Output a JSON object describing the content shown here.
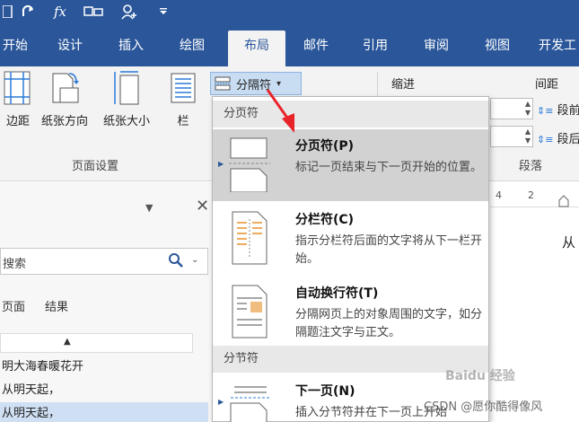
{
  "quick_access": {
    "formula_symbol": "fx"
  },
  "tabs": [
    "开始",
    "设计",
    "插入",
    "绘图",
    "布局",
    "邮件",
    "引用",
    "审阅",
    "视图",
    "开发工"
  ],
  "active_tab": "布局",
  "ribbon": {
    "margins_label": "边距",
    "orientation_label": "纸张方向",
    "size_label": "纸张大小",
    "columns_label": "栏",
    "page_setup_group": "页面设置",
    "breaks_label": "分隔符",
    "indent_label": "缩进",
    "spacing_label": "间距",
    "before_label": "段前",
    "after_label": "段后",
    "paragraph_group": "段落"
  },
  "pane": {
    "search_placeholder": "搜索",
    "tab_pages": "页面",
    "tab_results": "结果",
    "items": [
      "明大海春暖花开",
      "从明天起，",
      "从明天起，"
    ]
  },
  "ruler_marks": [
    "4",
    "2"
  ],
  "doc_text": "从",
  "menu": {
    "page_breaks_header": "分页符",
    "section_breaks_header": "分节符",
    "items": [
      {
        "title": "分页符(P)",
        "desc": "标记一页结束与下一页开始的位置。"
      },
      {
        "title": "分栏符(C)",
        "desc": "指示分栏符后面的文字将从下一栏开始。"
      },
      {
        "title": "自动换行符(T)",
        "desc": "分隔网页上的对象周围的文字，如分隔题注文字与正文。"
      },
      {
        "title": "下一页(N)",
        "desc": "插入分节符并在下一页上开始"
      }
    ]
  },
  "watermarks": {
    "baidu": "Baidu 经验",
    "csdn": "CSDN @愿你酷得像风"
  },
  "colors": {
    "accent": "#2b579a",
    "highlight": "#d2d2d2",
    "arrow": "#e8242a"
  }
}
